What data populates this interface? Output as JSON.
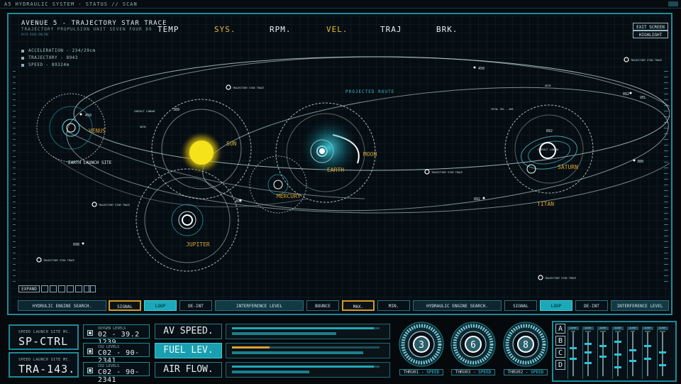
{
  "window": {
    "title": "A5 HYDRAULIC SYSTEM - STATUS // SCAN"
  },
  "header": {
    "title": "AVENUE 5 - TRAJECTORY STAR TRACE",
    "subtitle": "TRAJECTORY PROPULSION UNIT SEVEN FOUR 89",
    "tiny": "DATA READ ONLINE"
  },
  "nav_tabs": [
    {
      "label": "TEMP",
      "color": "#e8f2f4"
    },
    {
      "label": "SYS.",
      "color": "#e8b83a"
    },
    {
      "label": "RPM.",
      "color": "#e8f2f4"
    },
    {
      "label": "VEL.",
      "color": "#e8b83a"
    },
    {
      "label": "TRAJ",
      "color": "#e8f2f4"
    },
    {
      "label": "BRK.",
      "color": "#e8f2f4"
    }
  ],
  "top_buttons": {
    "exit": "EXIT SCREEN",
    "highlight": "HIGHLIGHT"
  },
  "stats": {
    "acceleration": "ACCELERATION - 234/29cm",
    "trajectory": "TRAJECTORY - 8943",
    "speed": "SPEED - 89324m"
  },
  "map": {
    "projected_route": "PROJECTED ROUTE",
    "earth_launch_site": "EARTH LAUNCH SITE",
    "vel_label": "VEL",
    "planets": {
      "venus": "VENUS",
      "sun": "SUN",
      "earth": "EARTH",
      "moon": "MOON",
      "mercury": "MERCURY",
      "jupiter": "JUPITER",
      "saturn": "SATURN",
      "titan": "TITAN"
    },
    "markers": {
      "m450": "450",
      "m_venus_450": "450",
      "m_sun_389": "389",
      "m_saturn_892": "892",
      "m_mercury_892": "892",
      "m_892_right": "892",
      "m_380": "380",
      "m_898": "898",
      "m_saturn_892_top": "892"
    },
    "traces": {
      "t1": "TRAJECTORY STAR TRACE",
      "t2": "TRAJECTORY STAR TRACE",
      "t3": "TRAJECTORY STAR TRACE",
      "t4": "TRAJECTORY STAR TRACE",
      "t5": "TRAJECTORY STAR TRACE",
      "t6": "TRAJECTORY STAR TRACE"
    },
    "small_labels": {
      "contact_linear": "CONTACT LINEAR",
      "contact_linear_2": "CONTACT LINEAR",
      "total_vel": "TOTAL VEL - 489",
      "v1": "567B",
      "v2": "567B"
    }
  },
  "expand_label": "EXPAND",
  "control_bar": [
    {
      "label": "HYDRULIC ENGINE SEARCH.",
      "style": "c-dark"
    },
    {
      "label": "SIGNAL",
      "style": "c-or"
    },
    {
      "label": "LOOP",
      "style": "c-cy"
    },
    {
      "label": "DE-INT",
      "style": "c-black"
    },
    {
      "label": "INTERFERENCE LEVEL",
      "style": "c-teal"
    },
    {
      "label": "BOUNCE",
      "style": "c-black"
    },
    {
      "label": "MAX.",
      "style": "c-or"
    },
    {
      "label": "MIN.",
      "style": "c-black"
    },
    {
      "label": "HYDRAULIC ENGINE SEARCH.",
      "style": "c-dark"
    },
    {
      "label": "SIGNAL",
      "style": "c-black"
    },
    {
      "label": "LOOP",
      "style": "c-cy"
    },
    {
      "label": "DE-INT",
      "style": "c-black"
    },
    {
      "label": "INTERFERENCE LEVEL",
      "style": "c-teal"
    }
  ],
  "launch_sites": [
    {
      "label": "SPEED LAUNCH SITE MC.",
      "value": "SP-CTRL"
    },
    {
      "label": "SPEED LAUNCH SITE MC.",
      "value": "TRA-143."
    }
  ],
  "levels": [
    {
      "label": "OXYGEN LEVELS",
      "value": "02 - 39.2 1239"
    },
    {
      "label": "CO2 LEVELS",
      "value": "C02 - 90-2341"
    },
    {
      "label": "CO2 LEVELS",
      "value": "C02 - 90-2341"
    }
  ],
  "big_buttons": [
    {
      "label": "AV SPEED.",
      "active": false
    },
    {
      "label": "FUEL LEV.",
      "active": true
    },
    {
      "label": "AIR FLOW.",
      "active": false
    }
  ],
  "bars": [
    {
      "fill_top": 0.95,
      "fill_bottom": 0.7,
      "color_top": "#1ea8b8"
    },
    {
      "fill_top": 0.25,
      "fill_bottom": 0.88,
      "color_top": "#d7a232"
    },
    {
      "fill_top": 0.95,
      "fill_bottom": 0.52,
      "color_top": "#1ea8b8"
    }
  ],
  "dials": [
    {
      "value": "3",
      "label": "THRU01",
      "sub": "SPEED"
    },
    {
      "value": "6",
      "label": "THRU03",
      "sub": "SPEED"
    },
    {
      "value": "8",
      "label": "THRU02",
      "sub": "SPEED"
    }
  ],
  "letters": [
    "A",
    "B",
    "C",
    "D"
  ],
  "channels": [
    {
      "label": "ALERT PHE",
      "knobs": [
        0.35,
        0.6
      ]
    },
    {
      "label": "ALERT EXIM",
      "knobs": [
        0.25,
        0.45,
        0.7
      ]
    },
    {
      "label": "ALERT EXIM",
      "knobs": [
        0.3,
        0.55
      ]
    },
    {
      "label": "ALERT EXIM",
      "knobs": [
        0.2,
        0.5,
        0.8
      ]
    },
    {
      "label": "ALERT PHE",
      "knobs": [
        0.4,
        0.65
      ]
    },
    {
      "label": "ALERT EXIM",
      "knobs": [
        0.3,
        0.6
      ]
    },
    {
      "label": "ALERT EXIM",
      "knobs": [
        0.45,
        0.75
      ]
    }
  ]
}
